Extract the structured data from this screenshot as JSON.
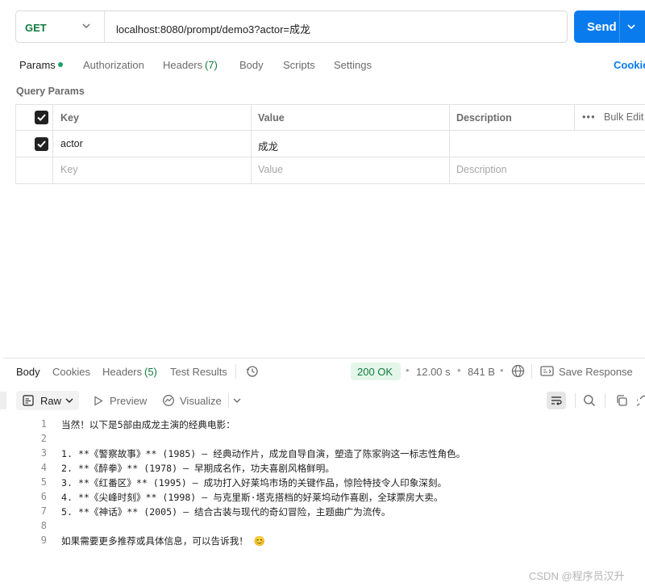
{
  "request": {
    "method": "GET",
    "url": "localhost:8080/prompt/demo3?actor=成龙",
    "send_label": "Send"
  },
  "request_tabs": [
    {
      "label": "Params"
    },
    {
      "label": "Authorization"
    },
    {
      "label": "Headers"
    },
    {
      "label": "(7)"
    },
    {
      "label": "Body"
    },
    {
      "label": "Scripts"
    },
    {
      "label": "Settings"
    }
  ],
  "cookies_link": "Cookie",
  "query_params": {
    "title": "Query Params",
    "headers": {
      "key": "Key",
      "value": "Value",
      "description": "Description"
    },
    "bulk_edit": "Bulk Edit",
    "bulk_dots": "•••",
    "rows": [
      {
        "key": "actor",
        "value": "成龙",
        "description": "",
        "checked": true
      }
    ],
    "placeholders": {
      "key": "Key",
      "value": "Value",
      "description": "Description"
    }
  },
  "response": {
    "tabs": {
      "body": "Body",
      "cookies": "Cookies",
      "headers": "Headers",
      "headers_count": "(5)",
      "test_results": "Test Results"
    },
    "status": "200 OK",
    "time": "12.00 s",
    "size": "841 B",
    "save_response": "Save Response",
    "toolbar": {
      "raw": "Raw",
      "preview": "Preview",
      "visualize": "Visualize"
    },
    "lines": [
      {
        "n": "1",
        "text": "当然！以下是5部由成龙主演的经典电影："
      },
      {
        "n": "2",
        "text": ""
      },
      {
        "n": "3",
        "text": "1. **《警察故事》** (1985) — 经典动作片，成龙自导自演，塑造了陈家驹这一标志性角色。"
      },
      {
        "n": "4",
        "text": "2. **《醉拳》** (1978) — 早期成名作，功夫喜剧风格鲜明。"
      },
      {
        "n": "5",
        "text": "3. **《红番区》** (1995) — 成功打入好莱坞市场的关键作品，惊险特技令人印象深刻。"
      },
      {
        "n": "6",
        "text": "4. **《尖峰时刻》** (1998) — 与克里斯·塔克搭档的好莱坞动作喜剧，全球票房大卖。"
      },
      {
        "n": "7",
        "text": "5. **《神话》** (2005) — 结合古装与现代的奇幻冒险，主题曲广为流传。"
      },
      {
        "n": "8",
        "text": ""
      },
      {
        "n": "9",
        "text": "如果需要更多推荐或具体信息，可以告诉我！ 😊"
      }
    ]
  },
  "watermark": "CSDN @程序员汉升",
  "colors": {
    "accent": "#097bed",
    "success": "#0f7b3f",
    "tab_dot": "#1aa260"
  },
  "icons": [
    "chevron-down-icon",
    "checkbox-checked-icon",
    "history-icon",
    "globe-icon",
    "save-response-icon",
    "raw-format-icon",
    "play-icon",
    "visualize-icon",
    "wrap-lines-icon",
    "search-icon",
    "copy-icon",
    "link-icon"
  ]
}
